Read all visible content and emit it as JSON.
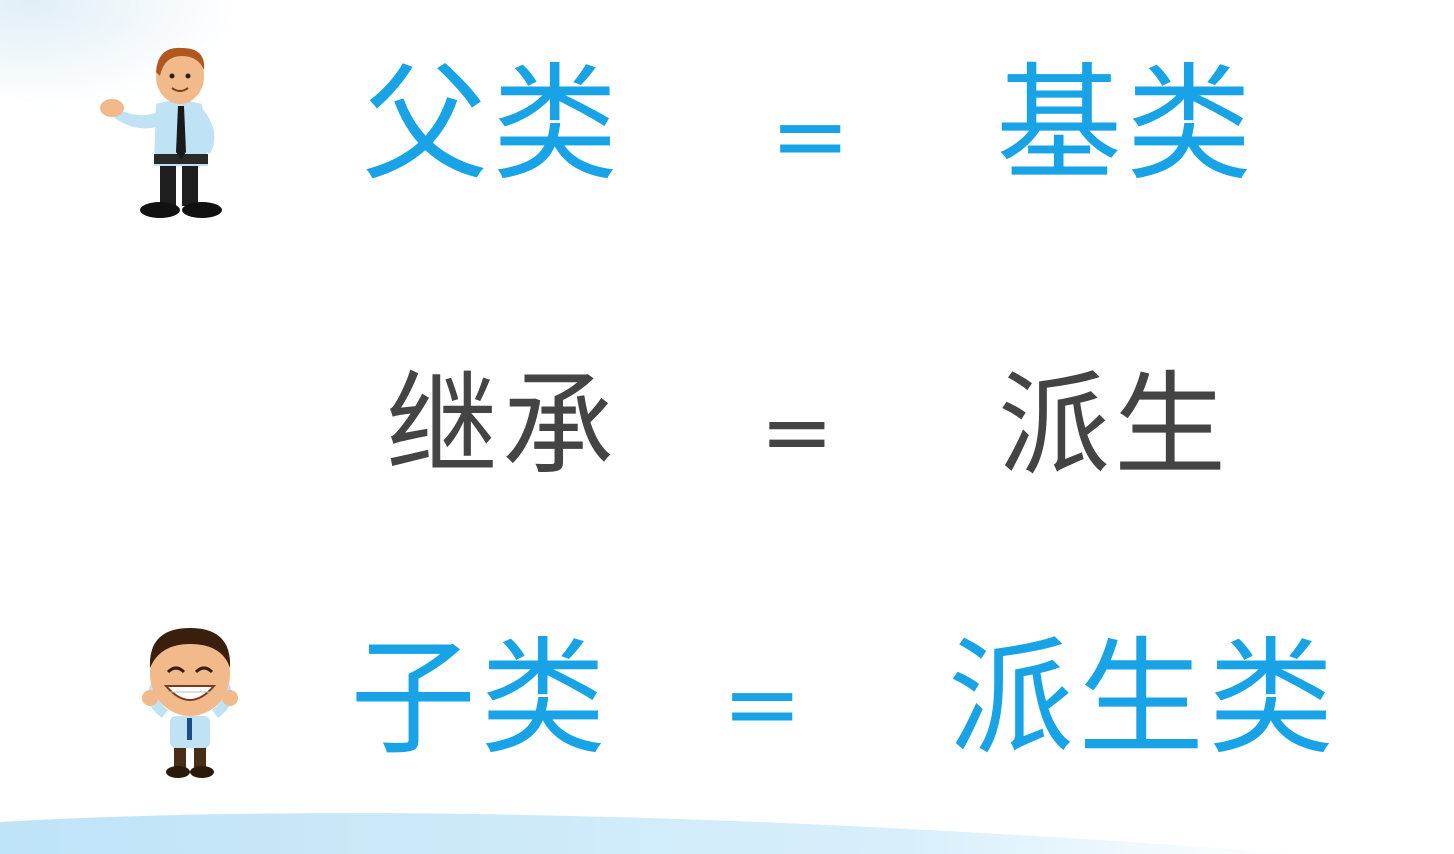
{
  "rows": {
    "top": {
      "left": "父类",
      "equals": "=",
      "right": "基类"
    },
    "middle": {
      "left": "继承",
      "equals": "=",
      "right": "派生"
    },
    "bottom": {
      "left": "子类",
      "equals": "=",
      "right": "派生类"
    }
  },
  "colors": {
    "accent": "#17a3e6",
    "text_dark": "#444444",
    "arrow": "#a8dcf5",
    "wave": "#cfeaf9"
  },
  "icons": {
    "top_figure": "businessman-pointing-figure",
    "bottom_figure": "smiling-boy-figure",
    "arrow": "up-triangle-arrow"
  }
}
